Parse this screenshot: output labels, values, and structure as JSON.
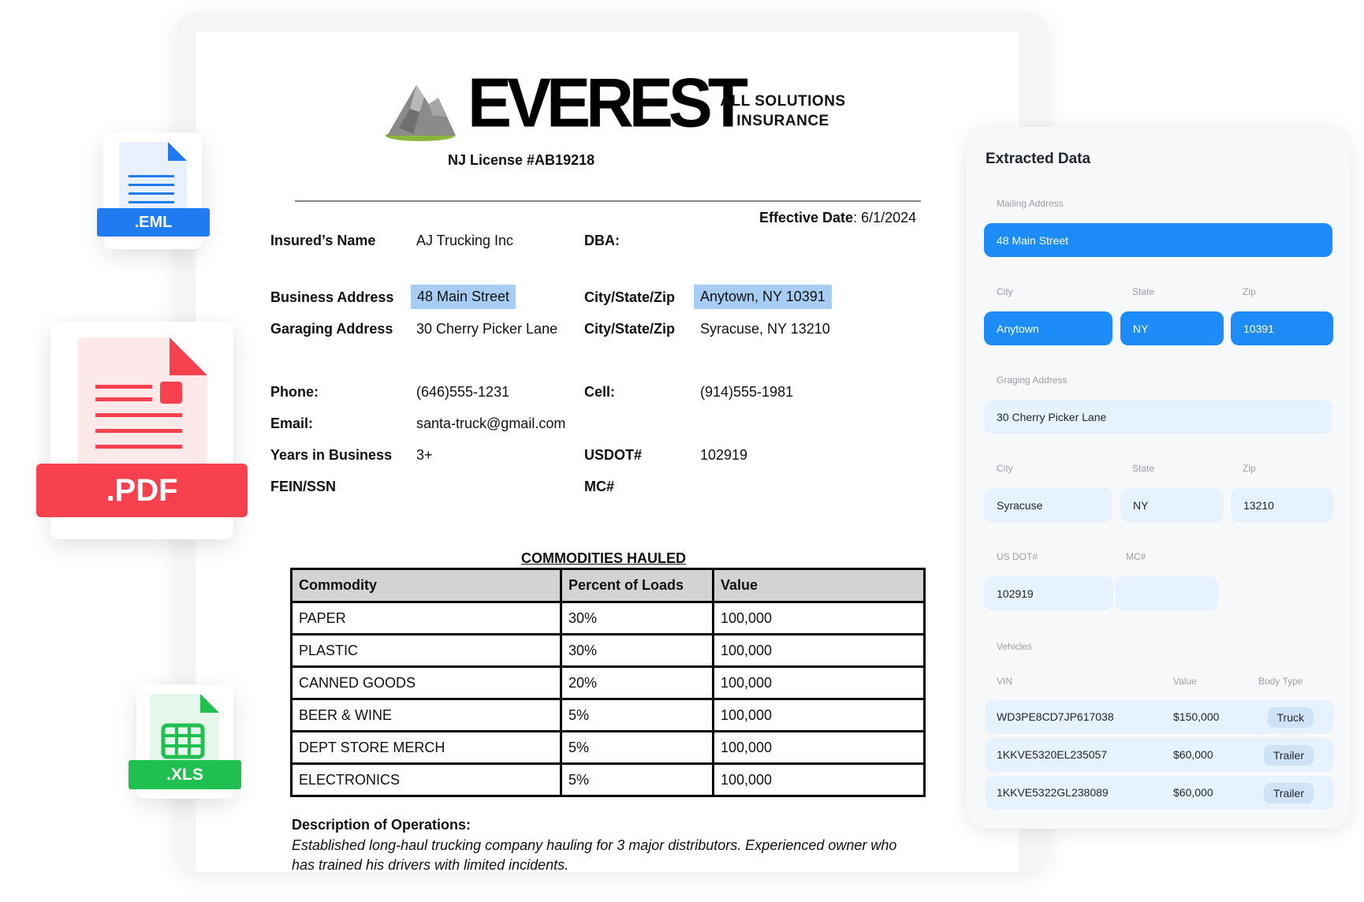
{
  "file_cards": {
    "eml": ".EML",
    "pdf": ".PDF",
    "xls": ".XLS"
  },
  "document": {
    "brand": "EVEREST",
    "tagline": "ALL SOLUTIONS INSURANCE",
    "license": "NJ License #AB19218",
    "effective_label": "Effective Date",
    "effective_value": ": 6/1/2024",
    "fields": {
      "insured_name_label": "Insured’s Name",
      "insured_name": "AJ Trucking Inc",
      "dba_label": "DBA:",
      "business_address_label": "Business Address",
      "business_address": "48 Main Street",
      "city_state_zip_label": "City/State/Zip",
      "business_city_state_zip": "Anytown, NY 10391",
      "garaging_address_label": "Garaging Address",
      "garaging_address": "30 Cherry Picker Lane",
      "garaging_city_state_zip_label": "City/State/Zip",
      "garaging_city_state_zip": "Syracuse, NY 13210",
      "phone_label": "Phone:",
      "phone": "(646)555-1231",
      "cell_label": "Cell:",
      "cell": "(914)555-1981",
      "email_label": "Email:",
      "email": "santa-truck@gmail.com",
      "years_label": "Years in Business",
      "years": "3+",
      "usdot_label": "USDOT#",
      "usdot": "102919",
      "fein_label": "FEIN/SSN",
      "mc_label": "MC#"
    },
    "commodities": {
      "title": "COMMODITIES HAULED",
      "headers": [
        "Commodity",
        "Percent of Loads",
        "Value"
      ],
      "rows": [
        [
          "PAPER",
          "30%",
          "100,000"
        ],
        [
          "PLASTIC",
          "30%",
          "100,000"
        ],
        [
          "CANNED GOODS",
          "20%",
          "100,000"
        ],
        [
          "BEER & WINE",
          "5%",
          "100,000"
        ],
        [
          "DEPT STORE MERCH",
          "5%",
          "100,000"
        ],
        [
          "ELECTRONICS",
          "5%",
          "100,000"
        ]
      ]
    },
    "operations_title": "Description of Operations:",
    "operations_text": "Established long-haul trucking company hauling for 3 major distributors. Experienced owner who has trained his drivers with limited incidents."
  },
  "panel": {
    "title": "Extracted Data",
    "mailing_address_label": "Mailing Address",
    "mailing_address": "48 Main Street",
    "city_label": "City",
    "state_label": "State",
    "zip_label": "Zip",
    "mailing_city": "Anytown",
    "mailing_state": "NY",
    "mailing_zip": "10391",
    "garaging_address_label": "Graging Address",
    "garaging_address": "30 Cherry Picker Lane",
    "garaging_city": "Syracuse",
    "garaging_state": "NY",
    "garaging_zip": "13210",
    "usdot_label": "US DOT#",
    "mc_label": "MC#",
    "usdot": "102919",
    "mc": "",
    "vehicles_label": "Vehicles",
    "vin_label": "VIN",
    "value_label": "Value",
    "body_type_label": "Body Type",
    "vehicles": [
      {
        "vin": "WD3PE8CD7JP617038",
        "value": "$150,000",
        "body": "Truck"
      },
      {
        "vin": "1KKVE5320EL235057",
        "value": "$60,000",
        "body": "Trailer"
      },
      {
        "vin": "1KKVE5322GL238089",
        "value": "$60,000",
        "body": "Trailer"
      }
    ]
  },
  "colors": {
    "accent": "#1d8cf8",
    "highlight": "#a8cdf5",
    "pdf_red": "#f7414f",
    "eml_blue": "#1e7cf0",
    "xls_green": "#1fc04f"
  }
}
